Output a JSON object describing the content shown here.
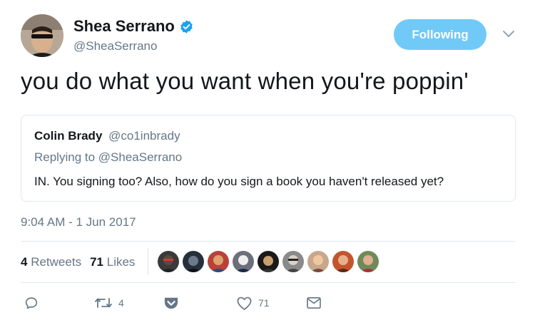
{
  "author": {
    "name": "Shea Serrano",
    "handle": "@SheaSerrano",
    "verified": true
  },
  "follow_button": {
    "label": "Following"
  },
  "tweet_text": "you do what you want when you're poppin'",
  "quoted": {
    "name": "Colin Brady",
    "handle": "@co1inbrady",
    "replying_to": "Replying to @SheaSerrano",
    "text": "IN. You signing too? Also, how do you sign a book you haven't released yet?"
  },
  "timestamp": "9:04 AM - 1 Jun 2017",
  "stats": {
    "retweets_count": "4",
    "retweets_label": "Retweets",
    "likes_count": "71",
    "likes_label": "Likes"
  },
  "actions": {
    "reply_icon": "reply-icon",
    "retweet_icon": "retweet-icon",
    "retweet_count": "4",
    "pocket_icon": "pocket-icon",
    "like_icon": "heart-icon",
    "like_count": "71",
    "dm_icon": "envelope-icon"
  },
  "colors": {
    "accent": "#71c9f8",
    "verified": "#1da1f2",
    "muted": "#657786",
    "text": "#14171a",
    "border": "#e1e8ed"
  }
}
